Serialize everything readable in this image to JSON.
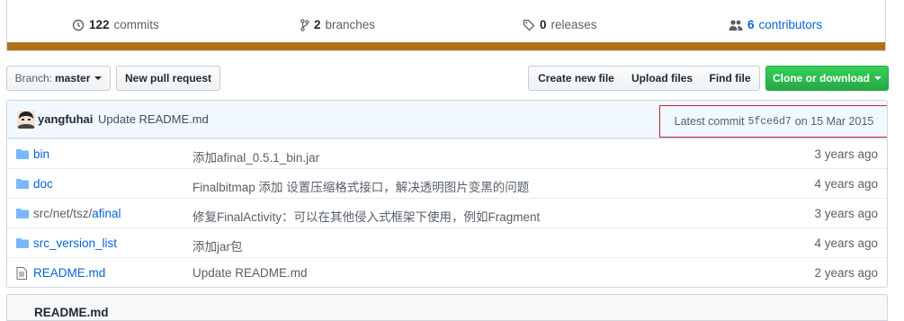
{
  "summary": {
    "commits": {
      "num": "122",
      "label": "commits",
      "icon": "history-icon"
    },
    "branches": {
      "num": "2",
      "label": "branches",
      "icon": "branch-icon"
    },
    "releases": {
      "num": "0",
      "label": "releases",
      "icon": "tag-icon"
    },
    "contributors": {
      "num": "6",
      "label": "contributors",
      "icon": "people-icon"
    },
    "language_color": "#b07219"
  },
  "toolbar": {
    "branch_label": "Branch:",
    "branch_value": "master",
    "new_pr": "New pull request",
    "create_file": "Create new file",
    "upload_files": "Upload files",
    "find_file": "Find file",
    "clone": "Clone or download"
  },
  "latest_commit": {
    "author": "yangfuhai",
    "message": "Update README.md",
    "prefix": "Latest commit",
    "sha": "5fce6d7",
    "date_text": "on 15 Mar 2015"
  },
  "files": [
    {
      "type": "dir",
      "name": "bin",
      "message": "添加afinal_0.5.1_bin.jar",
      "age": "3 years ago"
    },
    {
      "type": "dir",
      "name": "doc",
      "message": "Finalbitmap 添加 设置压缩格式接口，解决透明图片变黑的问题",
      "age": "4 years ago"
    },
    {
      "type": "dir",
      "name_prefix": "src/net/tsz/",
      "name": "afinal",
      "message": "修复FinalActivity：可以在其他侵入式框架下使用，例如Fragment",
      "age": "3 years ago"
    },
    {
      "type": "dir",
      "name": "src_version_list",
      "message": "添加jar包",
      "age": "4 years ago"
    },
    {
      "type": "file",
      "name": "README.md",
      "message": "Update README.md",
      "age": "2 years ago"
    }
  ],
  "readme": {
    "title": "README.md"
  },
  "colors": {
    "link": "#0366d6",
    "green": "#28a745",
    "highlight_border": "#cb2431"
  }
}
